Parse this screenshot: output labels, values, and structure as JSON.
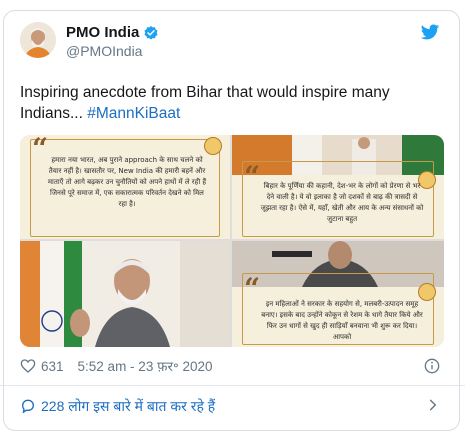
{
  "tweet": {
    "author_name": "PMO India",
    "handle": "@PMOIndia",
    "text_main": "Inspiring anecdote from Bihar that would inspire many Indians... ",
    "hashtag": "#MannKiBaat",
    "likes": "631",
    "timestamp": "5:52 am - 23 फ़र॰ 2020",
    "reply_link": "228 लोग इस बारे में बात कर रहे हैं"
  },
  "media": {
    "tile1_text": "हमारा नया भारत, अब पुराने approach के साथ चलने को तैयार नहीं है। खासतौर पर, New India की हमारी बहनें और माताएँ तो आगे बढ़कर उन चुनौतियों को अपने हाथों में ले रही हैं जिनसे पूरे समाज में, एक सकारात्मक परिवर्तन देखने को मिल रहा है।",
    "tile2_text": "बिहार के पूर्णिया की कहानी, देश-भर के लोगों को प्रेरणा से भर देने वाली है। ये वो इलाका है जो दशकों से बाढ़ की त्रासदी से जूझता रहा है। ऐसे में, यहाँ, खेती और आय के अन्य संसाधनों को जुटाना बहुत",
    "tile4_text": "इन महिलाओं ने सरकार के सहयोग से, मलबरी-उत्पादन समूह बनाए। इसके बाद उन्होंने कोकून से रेशम के धागे तैयार किये और फिर उन धागों से खुद ही साड़ियाँ बनवाना भी शुरू कर दिया। आपको"
  },
  "colors": {
    "link": "#1b6ec2",
    "muted": "#657786",
    "twitter_blue": "#1da1f2"
  },
  "icons": [
    "verified-badge-icon",
    "twitter-bird-icon",
    "heart-icon",
    "info-icon",
    "reply-bubble-icon",
    "chevron-right-icon"
  ]
}
